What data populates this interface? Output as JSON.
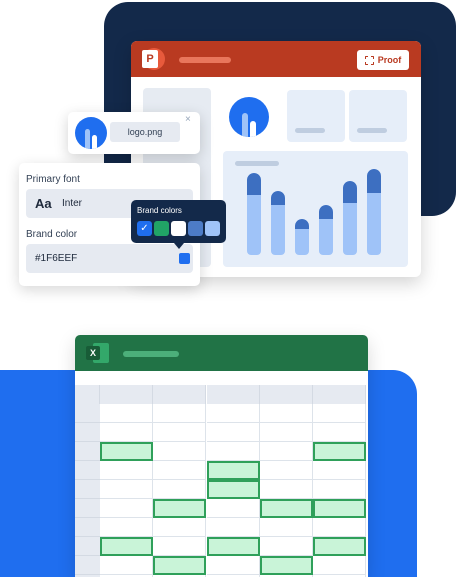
{
  "powerpoint": {
    "app_icon": "powerpoint-icon",
    "app_letter": "P",
    "proof_label": "Proof",
    "proof_icon": "frame-icon",
    "chart_bars": [
      {
        "total": 0.82,
        "dark": 0.22
      },
      {
        "total": 0.64,
        "dark": 0.14
      },
      {
        "total": 0.36,
        "dark": 0.1
      },
      {
        "total": 0.5,
        "dark": 0.14
      },
      {
        "total": 0.74,
        "dark": 0.22
      },
      {
        "total": 0.86,
        "dark": 0.24
      }
    ]
  },
  "logo_file": {
    "name": "logo.png",
    "close_symbol": "×"
  },
  "brand": {
    "font_label": "Primary font",
    "font_sample": "Aa",
    "font_name": "Inter",
    "color_label": "Brand color",
    "color_hex": "#1F6EEF",
    "color": "#1f6eef"
  },
  "brand_colors_popup": {
    "title": "Brand colors",
    "check": "✓",
    "colors": [
      "#1f6eef",
      "#21a366",
      "#ffffff",
      "#4d7cc7",
      "#9fc3f8"
    ]
  },
  "excel": {
    "app_icon": "excel-icon",
    "app_letter": "X",
    "highlighted_cells": [
      [
        2,
        0
      ],
      [
        2,
        4
      ],
      [
        3,
        2
      ],
      [
        4,
        2
      ],
      [
        5,
        1
      ],
      [
        5,
        3
      ],
      [
        5,
        4
      ],
      [
        7,
        0
      ],
      [
        7,
        2
      ],
      [
        7,
        4
      ],
      [
        8,
        1
      ],
      [
        8,
        3
      ]
    ]
  },
  "colors": {
    "navy": "#13294a",
    "blue": "#1f6eef",
    "ppt_red": "#b93a21",
    "excel_green": "#217346"
  }
}
